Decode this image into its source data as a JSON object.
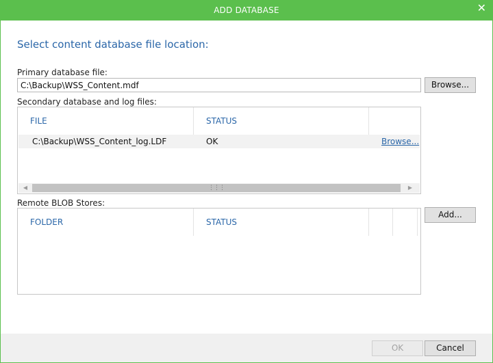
{
  "window": {
    "title": "ADD DATABASE",
    "close_glyph": "✕",
    "accent_color": "#5bbf4d",
    "heading_color": "#2a66a8"
  },
  "main": {
    "heading": "Select content database file location:",
    "primary": {
      "label": "Primary database file:",
      "value": "C:\\Backup\\WSS_Content.mdf",
      "browse_label": "Browse..."
    },
    "secondary": {
      "label": "Secondary database and log files:",
      "columns": [
        "FILE",
        "STATUS"
      ],
      "rows": [
        {
          "file": "C:\\Backup\\WSS_Content_log.LDF",
          "status": "OK",
          "action": "Browse..."
        }
      ]
    },
    "blob": {
      "label": "Remote BLOB Stores:",
      "columns": [
        "FOLDER",
        "STATUS"
      ],
      "add_label": "Add..."
    }
  },
  "footer": {
    "ok_label": "OK",
    "cancel_label": "Cancel"
  },
  "icons": {
    "close": "close-icon",
    "scroll_left": "scroll-left-icon",
    "scroll_right": "scroll-right-icon",
    "scroll_grip": "scroll-grip-icon"
  }
}
